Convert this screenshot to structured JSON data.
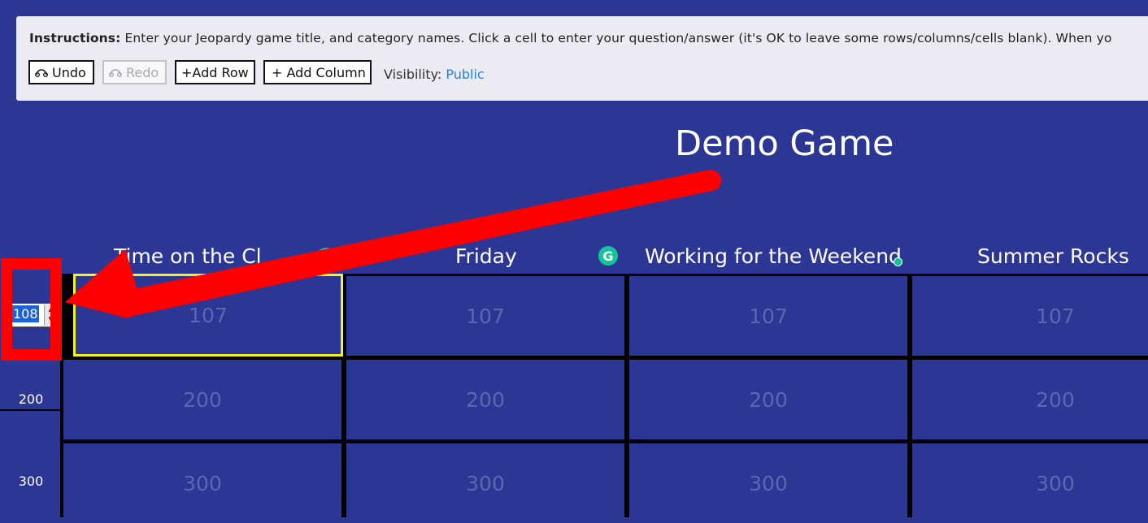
{
  "toolbar": {
    "instructions_label": "Instructions:",
    "instructions_text": "Enter your Jeopardy game title, and category names. Click a cell to enter your question/answer (it's OK to leave some rows/columns/cells blank). When yo",
    "undo_label": "Undo",
    "redo_label": "Redo",
    "add_row_label": "+Add Row",
    "add_column_label": "+ Add Column",
    "visibility_label": "Visibility:",
    "visibility_value": "Public"
  },
  "game": {
    "title": "Demo Game",
    "categories": [
      "Time on the Cl",
      "Friday",
      "Working for the Weekend",
      "Summer Rocks"
    ],
    "rows": [
      {
        "label_input": "108",
        "cells": [
          "107",
          "107",
          "107",
          "107"
        ]
      },
      {
        "label": "200",
        "cells": [
          "200",
          "200",
          "200",
          "200"
        ]
      },
      {
        "label": "300",
        "cells": [
          "300",
          "300",
          "300",
          "300"
        ]
      }
    ]
  },
  "colors": {
    "board_background": "#2c3795",
    "selected_cell_border": "#f6f01c",
    "annotation": "#ff0000",
    "grammarly": "#15c39a"
  }
}
